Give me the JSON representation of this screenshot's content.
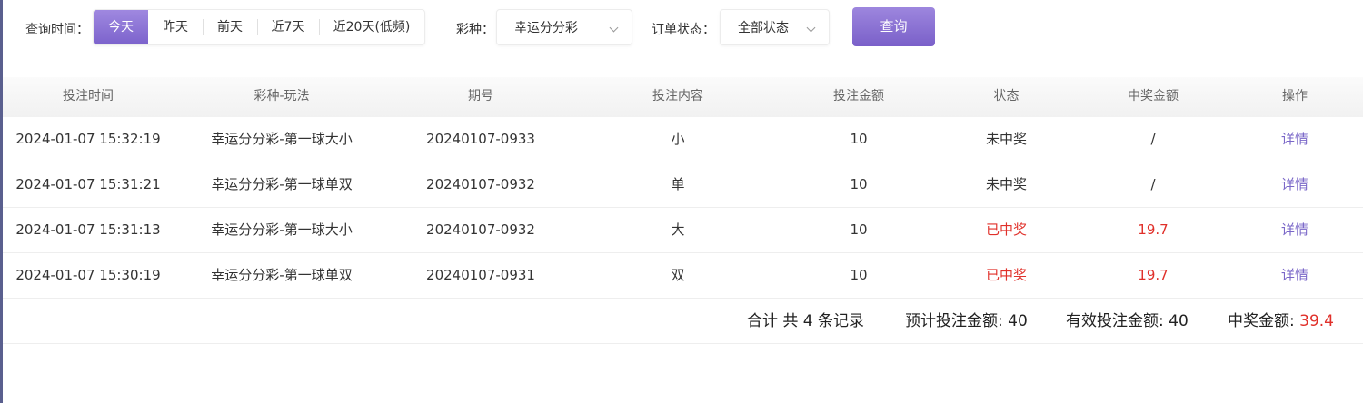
{
  "filters": {
    "time_label": "查询时间：",
    "time_options": [
      "今天",
      "昨天",
      "前天",
      "近7天",
      "近20天(低频)"
    ],
    "lottery_label": "彩种：",
    "lottery_value": "幸运分分彩",
    "status_label": "订单状态：",
    "status_value": "全部状态",
    "query_label": "查询"
  },
  "table": {
    "headers": [
      "投注时间",
      "彩种-玩法",
      "期号",
      "投注内容",
      "投注金额",
      "状态",
      "中奖金额",
      "操作"
    ],
    "rows": [
      [
        "2024-01-07 15:32:19",
        "幸运分分彩-第一球大小",
        "20240107-0933",
        "小",
        "10",
        "未中奖",
        "/",
        "详情"
      ],
      [
        "2024-01-07 15:31:21",
        "幸运分分彩-第一球单双",
        "20240107-0932",
        "单",
        "10",
        "未中奖",
        "/",
        "详情"
      ],
      [
        "2024-01-07 15:31:13",
        "幸运分分彩-第一球大小",
        "20240107-0932",
        "大",
        "10",
        "已中奖",
        "19.7",
        "详情"
      ],
      [
        "2024-01-07 15:30:19",
        "幸运分分彩-第一球单双",
        "20240107-0931",
        "双",
        "10",
        "已中奖",
        "19.7",
        "详情"
      ]
    ]
  },
  "summary": {
    "total_text": "合计 共 4 条记录",
    "expected_label": "预计投注金额: ",
    "expected_value": "40",
    "valid_label": "有效投注金额: ",
    "valid_value": "40",
    "win_label": "中奖金额: ",
    "win_value": "39.4"
  },
  "colors": {
    "accent": "#7c63cc",
    "win_red": "#e0302a",
    "link": "#7a67c8"
  }
}
